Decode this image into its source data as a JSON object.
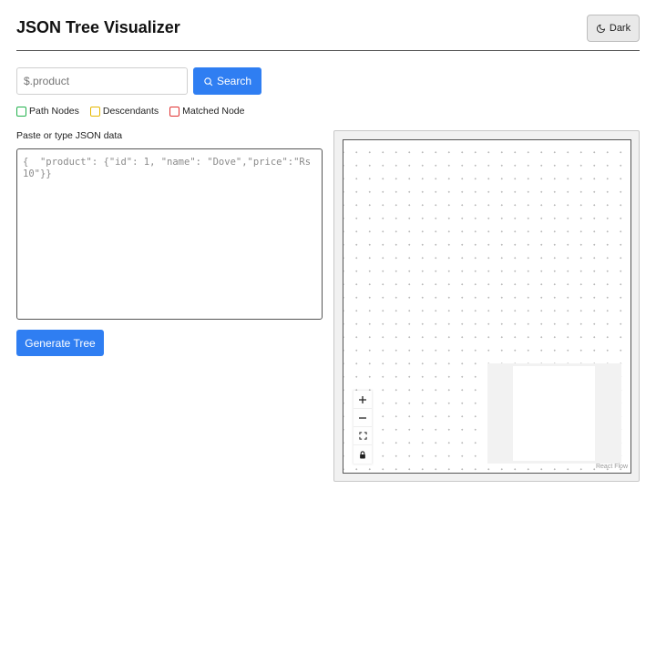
{
  "header": {
    "title": "JSON Tree Visualizer",
    "theme_button_label": "Dark"
  },
  "search": {
    "placeholder": "$.product",
    "button_label": "Search"
  },
  "legend": {
    "items": [
      {
        "label": "Path Nodes",
        "color": "#22b14c"
      },
      {
        "label": "Descendants",
        "color": "#e6b800"
      },
      {
        "label": "Matched Node",
        "color": "#e03131"
      }
    ]
  },
  "editor": {
    "label": "Paste or type JSON data",
    "placeholder": "{  \"product\": {\"id\": 1, \"name\": \"Dove\",\"price\":\"Rs 10\"}}",
    "value": "",
    "generate_label": "Generate Tree"
  },
  "flow": {
    "controls": [
      "zoom-in",
      "zoom-out",
      "fit-view",
      "lock"
    ],
    "attribution": "React Flow"
  },
  "colors": {
    "primary": "#2f7ef2",
    "border_dark": "#555555"
  }
}
